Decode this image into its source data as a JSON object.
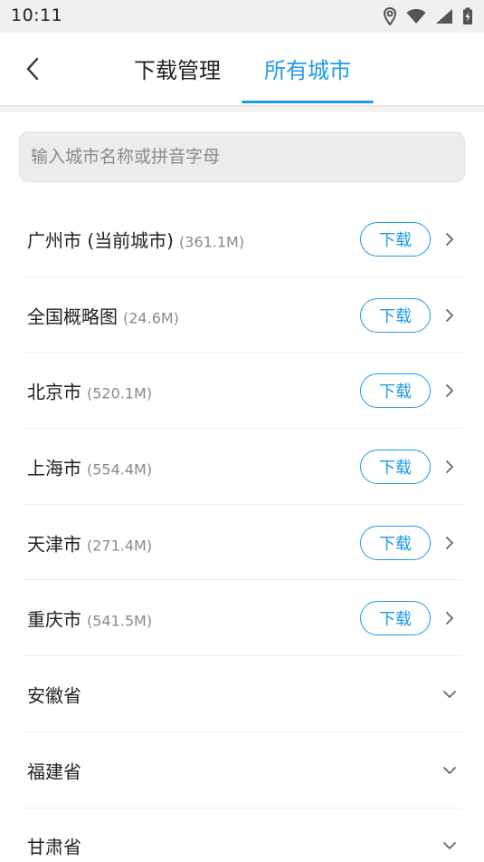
{
  "status_bar": {
    "time": "10:11",
    "icons": [
      "location-icon",
      "wifi-icon",
      "signal-icon",
      "battery-charging-icon"
    ]
  },
  "nav": {
    "tabs": [
      {
        "label": "下载管理",
        "active": false
      },
      {
        "label": "所有城市",
        "active": true
      }
    ],
    "accent_color": "#1e9be8"
  },
  "search": {
    "placeholder": "输入城市名称或拼音字母",
    "value": ""
  },
  "cities": [
    {
      "name": "广州市 (当前城市)",
      "size": "(361.1M)",
      "button": "下载"
    },
    {
      "name": "全国概略图",
      "size": "(24.6M)",
      "button": "下载"
    },
    {
      "name": "北京市",
      "size": "(520.1M)",
      "button": "下载"
    },
    {
      "name": "上海市",
      "size": "(554.4M)",
      "button": "下载"
    },
    {
      "name": "天津市",
      "size": "(271.4M)",
      "button": "下载"
    },
    {
      "name": "重庆市",
      "size": "(541.5M)",
      "button": "下载"
    }
  ],
  "provinces": [
    {
      "name": "安徽省"
    },
    {
      "name": "福建省"
    },
    {
      "name": "甘肃省"
    }
  ]
}
